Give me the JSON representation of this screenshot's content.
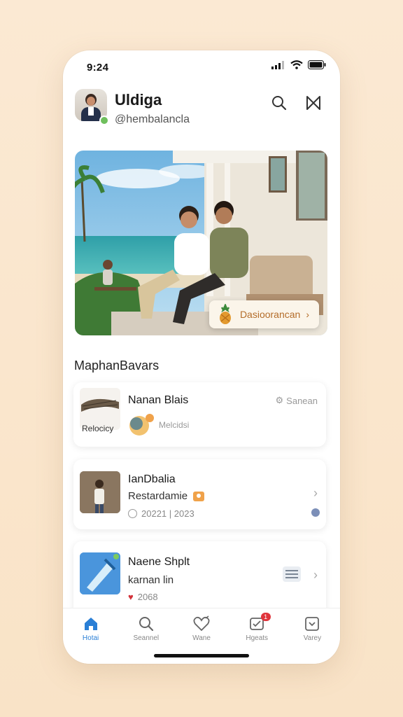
{
  "status": {
    "time": "9:24"
  },
  "profile": {
    "name": "Uldiga",
    "handle": "@hembalancla"
  },
  "hero": {
    "cta_label": "Dasioorancan"
  },
  "section": {
    "title": "MaphanBavars"
  },
  "cards": [
    {
      "title": "Nanan Blais",
      "thumb_label": "Relocicy",
      "badge": "Sanean",
      "meta": "Melcidsi"
    },
    {
      "title": "IanDbalia",
      "subtitle": "Restardamie",
      "meta": "20221 | 2023"
    },
    {
      "title": "Naene Shplt",
      "subtitle": "karnan lin",
      "meta": "2068"
    }
  ],
  "tabs": [
    {
      "label": "Hotai",
      "icon": "home-icon",
      "active": true
    },
    {
      "label": "Seannel",
      "icon": "search-icon"
    },
    {
      "label": "Wane",
      "icon": "heart-icon"
    },
    {
      "label": "Hgeats",
      "icon": "inbox-icon",
      "badge": "1"
    },
    {
      "label": "Varey",
      "icon": "chevron-box-icon"
    }
  ],
  "colors": {
    "accent": "#2a7fd6",
    "cta_text": "#b46d2a",
    "background": "#fbe9d3"
  }
}
